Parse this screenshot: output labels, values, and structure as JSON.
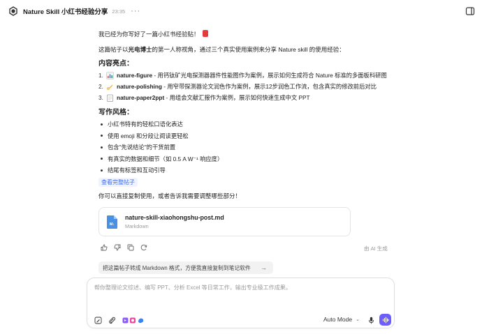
{
  "topbar": {
    "title": "Nature Skill 小红书经验分享",
    "time": "23:35",
    "more": "···"
  },
  "message": {
    "intro": "我已经为你写好了一篇小红书经验贴！",
    "desc_prefix": "这篇帖子以",
    "desc_bold": "光电博士",
    "desc_suffix": "的第一人称视角，通过三个真实使用案例来分享 Nature skill 的使用经验：",
    "highlights_heading": "内容亮点：",
    "highlights": [
      {
        "num": "1.",
        "icon": "bar-chart-emoji",
        "title": "nature-figure",
        "text": " - 用钙钛矿光电探测器器件性能图作为案例，展示如何生成符合 Nature 标准的多面板科研图"
      },
      {
        "num": "2.",
        "icon": "writing-hand-emoji",
        "title": "nature-polishing",
        "text": " - 用窄带探测器论文润色作为案例，展示12步润色工作流，包含真实的修改前后对比"
      },
      {
        "num": "3.",
        "icon": "notepad-emoji",
        "title": "nature-paper2ppt",
        "text": " - 用组会文献汇报作为案例，展示如何快速生成中文 PPT"
      }
    ],
    "style_heading": "写作风格：",
    "style_items": [
      "小红书特有的轻松口语化表达",
      "使用 emoji 和分段让阅读更轻松",
      "包含\"先说结论\"的干货前置",
      "有真实的数据和细节（如 0.5 A W⁻¹ 响应度）",
      "结尾有标签和互动引导"
    ],
    "view_full_link": "查看完整帖子",
    "closing": "你可以直接复制使用，或者告诉我需要调整哪些部分！"
  },
  "file_card": {
    "name": "nature-skill-xiaohongshu-post.md",
    "type": "Markdown",
    "badge": "M↓"
  },
  "ai_generated": "由 AI 生成",
  "suggestion": {
    "text": "把这篇帖子转成 Markdown 格式，方便我直接复制到笔记软件",
    "arrow": "→"
  },
  "composer": {
    "placeholder": "帮你整理论文综述、编写 PPT、分析 Excel 等日常工作，输出专业级工作成果。",
    "mode": "Auto Mode"
  },
  "colors": {
    "accent": "#6d5dfc",
    "link": "#3d6cf0",
    "file_icon": "#4a90e2",
    "red_book": "#e23c3c"
  }
}
